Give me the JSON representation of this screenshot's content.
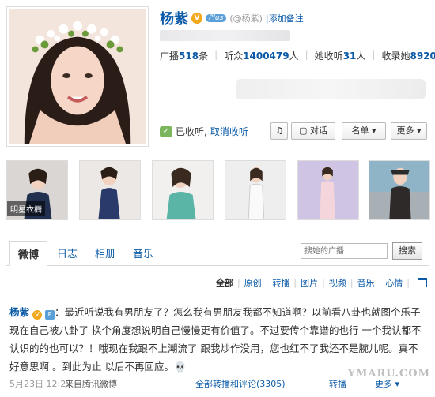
{
  "profile": {
    "name": "杨紫",
    "verified_icon": "verified-v-icon",
    "level_badge": "Plus",
    "handle": "(@杨紫)",
    "remark_link": "添加备注",
    "stats": {
      "posts_label": "广播",
      "posts_value": "518",
      "posts_unit": "条",
      "listeners_label": "听众",
      "listeners_value": "1400479",
      "listeners_unit": "人",
      "following_label": "她收听",
      "following_value": "31",
      "following_unit": "人",
      "collection_label": "收录她",
      "collection_value": "8920"
    },
    "follow_status": "已收听,",
    "cancel_follow": "取消收听",
    "buttons": {
      "chat": "对话",
      "list": "名单 ▾",
      "more": "更多 ▾"
    }
  },
  "photos": {
    "first_label": "明星衣橱"
  },
  "tabs": {
    "items": [
      "微博",
      "日志",
      "相册",
      "音乐"
    ],
    "search_placeholder": "搜她的广播",
    "search_button": "搜索"
  },
  "filters": [
    "全部",
    "原创",
    "转播",
    "图片",
    "视频",
    "音乐",
    "心情"
  ],
  "post": {
    "author": "杨紫",
    "text": "：最近听说我有男朋友了？怎么我有男朋友我都不知道啊？以前看八卦也就图个乐子 现在自己被八卦了 换个角度想说明自己慢慢更有价值了。不过要传个靠谱的也行 一个我认都不认识的的也可以？！哦现在我跟不上潮流了 跟我炒作没用，您也红不了我还不是腕儿呢。真不好意思啊 。到此为止 以后不再回应。💀",
    "date": "5月23日",
    "time": "12:27",
    "source": "来自腾讯微博",
    "forwards_text": "全部转播和评论(3305)",
    "action_forward": "转播",
    "action_more": "更多 ▾"
  },
  "watermark": "YMARU.COM",
  "colors": {
    "link_blue": "#0a5aa6",
    "verified_orange": "#f2a81d"
  }
}
